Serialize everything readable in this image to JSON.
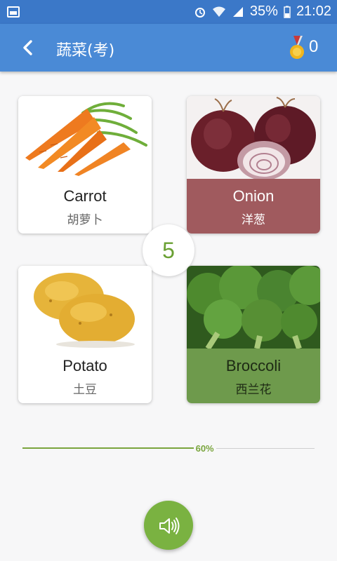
{
  "status_bar": {
    "battery": "35%",
    "time": "21:02"
  },
  "header": {
    "title": "蔬菜(考)",
    "score": "0"
  },
  "cards": [
    {
      "en": "Carrot",
      "zh": "胡萝卜",
      "state": "neutral"
    },
    {
      "en": "Onion",
      "zh": "洋葱",
      "state": "wrong"
    },
    {
      "en": "Potato",
      "zh": "土豆",
      "state": "neutral"
    },
    {
      "en": "Broccoli",
      "zh": "西兰花",
      "state": "right"
    }
  ],
  "countdown": "5",
  "progress": {
    "value": 0.6,
    "label": "60%"
  },
  "colors": {
    "primary": "#4a8ad6",
    "accent": "#7ab241",
    "wrong": "#a05a5e",
    "right": "#6e9a4c"
  }
}
